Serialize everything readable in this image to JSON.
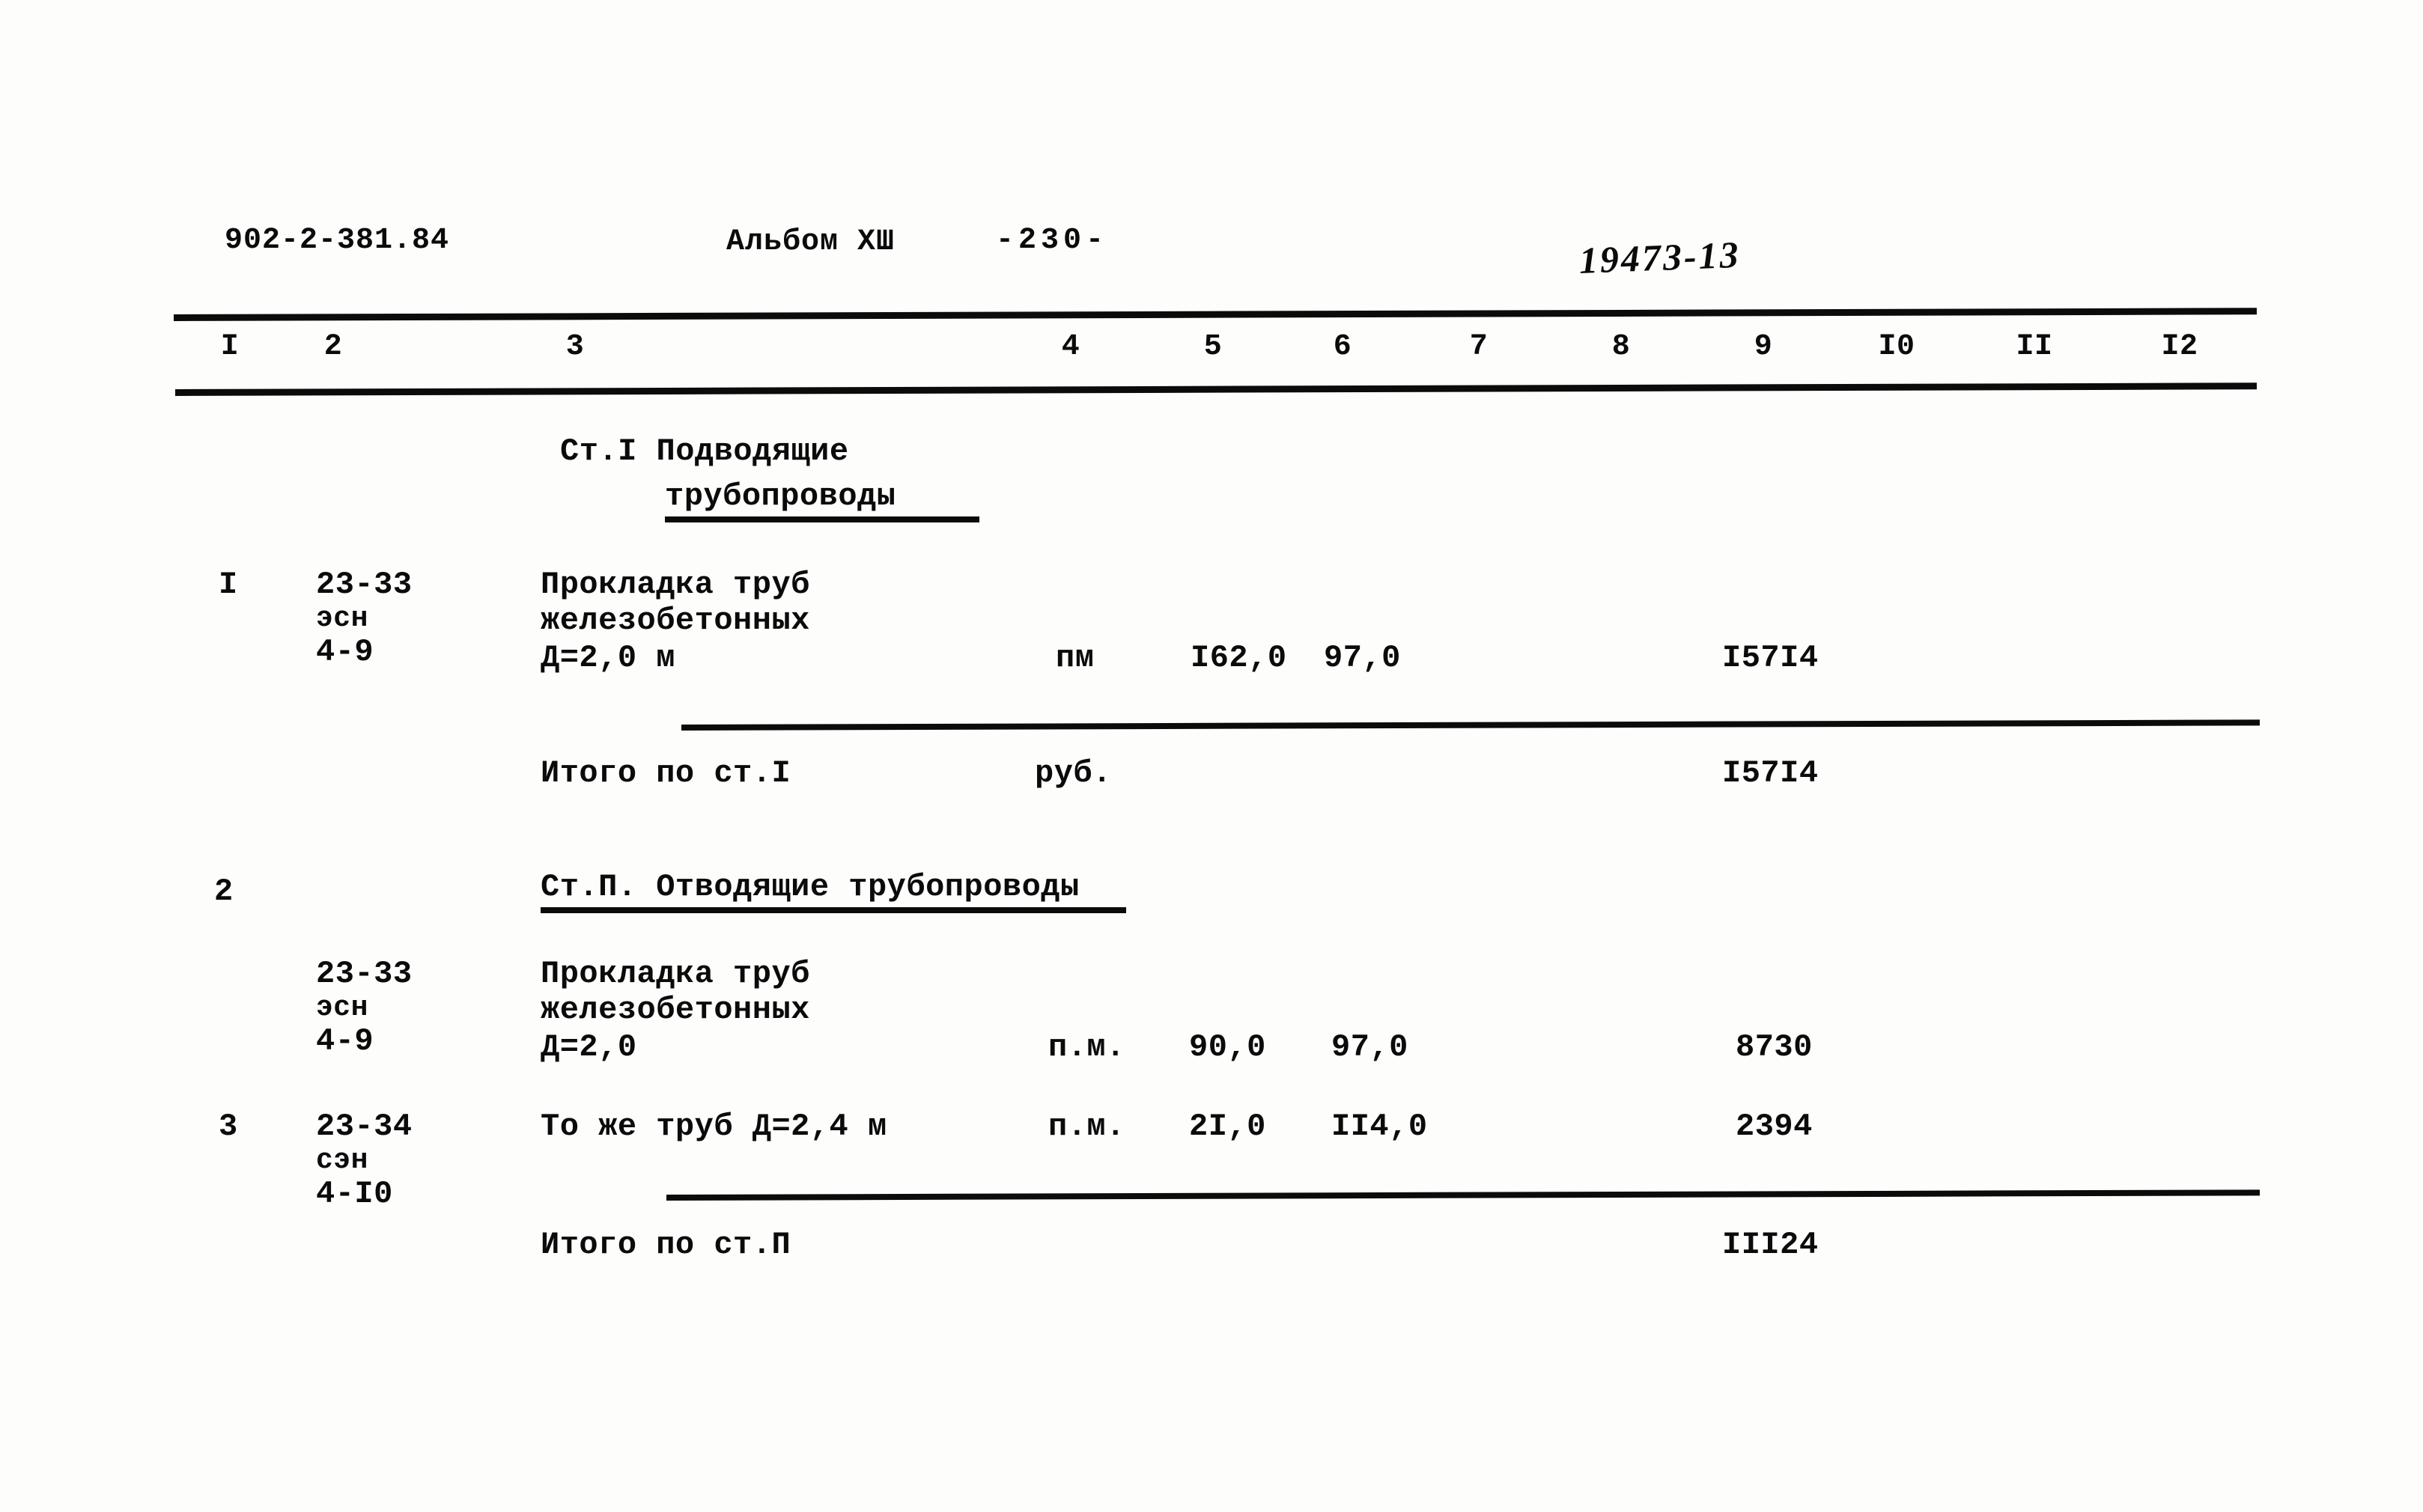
{
  "document": {
    "series_code": "902-2-381.84",
    "album": "Альбом ХШ",
    "page_marker": "-230-",
    "archive_number": "19473-13"
  },
  "table": {
    "column_numbers": [
      "I",
      "2",
      "3",
      "4",
      "5",
      "6",
      "7",
      "8",
      "9",
      "I0",
      "II",
      "I2"
    ],
    "sections": [
      {
        "heading_line1": "Ст.I Подводящие",
        "heading_line2": "трубопроводы",
        "rows": [
          {
            "num": "I",
            "code_line1": "23-33",
            "code_line2": "эсн",
            "code_line3": "4-9",
            "name_line1": "Прокладка труб",
            "name_line2": "железобетонных",
            "name_line3": "Д=2,0 м",
            "unit": "пм",
            "qty": "I62,0",
            "price": "97,0",
            "total": "I57I4"
          }
        ],
        "subtotal_label": "Итого по ст.I",
        "subtotal_unit": "руб.",
        "subtotal_value": "I57I4"
      },
      {
        "row_num": "2",
        "heading_line1": "Ст.П. Отводящие трубопроводы",
        "rows": [
          {
            "num": "",
            "code_line1": "23-33",
            "code_line2": "эсн",
            "code_line3": "4-9",
            "name_line1": "Прокладка труб",
            "name_line2": "железобетонных",
            "name_line3": "Д=2,0",
            "unit": "п.м.",
            "qty": "90,0",
            "price": "97,0",
            "total": "8730"
          },
          {
            "num": "3",
            "code_line1": "23-34",
            "code_line2": "сэн",
            "code_line3": "4-I0",
            "name_line1": "То же труб Д=2,4 м",
            "name_line2": "",
            "name_line3": "",
            "unit": "п.м.",
            "qty": "2I,0",
            "price": "II4,0",
            "total": "2394"
          }
        ],
        "subtotal_label": "Итого по ст.П",
        "subtotal_unit": "",
        "subtotal_value": "III24"
      }
    ]
  }
}
